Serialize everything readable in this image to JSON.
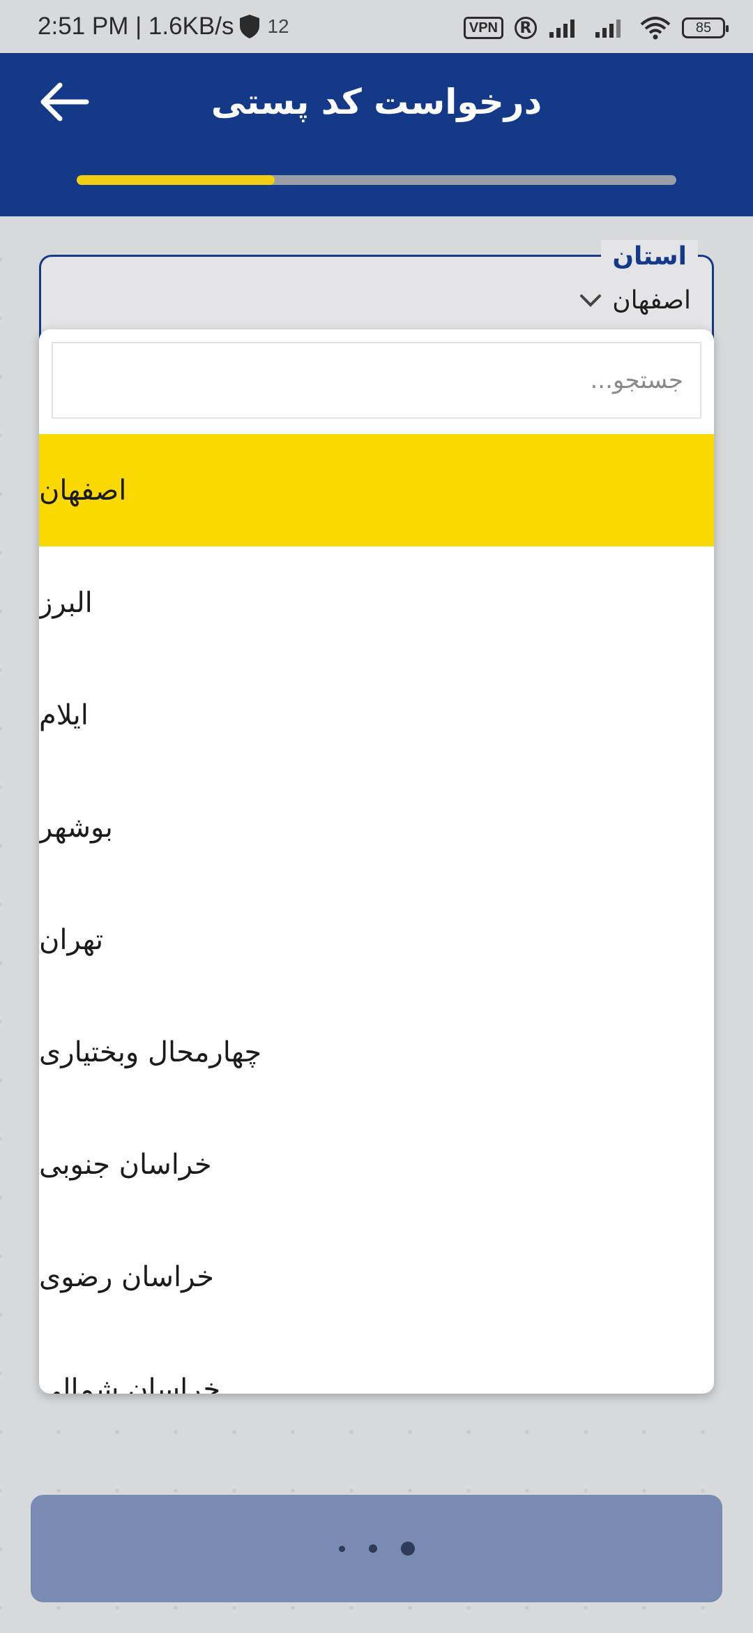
{
  "status_bar": {
    "time_speed": "2:51 PM | 1.6KB/s",
    "notification_count": "12",
    "vpn": "VPN",
    "r_badge": "R",
    "battery": "85"
  },
  "header": {
    "title": "درخواست کد پستی",
    "progress_fraction": 0.33,
    "colors": {
      "header_bg": "#143988",
      "progress": "#f2cf10"
    }
  },
  "province_field": {
    "label": "استان",
    "value": "اصفهان"
  },
  "dropdown": {
    "search_placeholder": "جستجو...",
    "options": [
      {
        "label": "اصفهان",
        "selected": true
      },
      {
        "label": "البرز",
        "selected": false
      },
      {
        "label": "ایلام",
        "selected": false
      },
      {
        "label": "بوشهر",
        "selected": false
      },
      {
        "label": "تهران",
        "selected": false
      },
      {
        "label": "چهارمحال وبختیاری",
        "selected": false
      },
      {
        "label": "خراسان جنوبی",
        "selected": false
      },
      {
        "label": "خراسان رضوی",
        "selected": false
      },
      {
        "label": "خراسان شمالی",
        "selected": false
      }
    ],
    "colors": {
      "selected_bg": "#fbd800"
    }
  },
  "bottom_button": {
    "state": "loading",
    "colors": {
      "bg": "#778bb3"
    }
  }
}
